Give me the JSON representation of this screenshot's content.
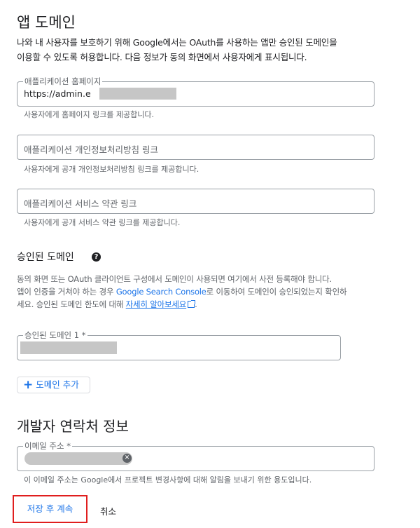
{
  "app_domain": {
    "title": "앱 도메인",
    "description_line1": "나와 내 사용자를 보호하기 위해 Google에서는 OAuth를 사용하는 앱만 승인된 도메인을",
    "description_line2": "이용할 수 있도록 허용합니다. 다음 정보가 동의 화면에서 사용자에게 표시됩니다.",
    "homepage": {
      "label": "애플리케이션 홈페이지",
      "value": "https://admin.e",
      "help": "사용자에게 홈페이지 링크를 제공합니다."
    },
    "privacy": {
      "placeholder": "애플리케이션 개인정보처리방침 링크",
      "help": "사용자에게 공개 개인정보처리방침 링크를 제공합니다."
    },
    "tos": {
      "placeholder": "애플리케이션 서비스 약관 링크",
      "help": "사용자에게 공개 서비스 약관 링크를 제공합니다."
    }
  },
  "authorized_domains": {
    "title": "승인된 도메인",
    "help_icon": "?",
    "desc_line1": "동의 화면 또는 OAuth 클라이언트 구성에서 도메인이 사용되면 여기에서 사전 등록해야 합니다.",
    "desc_line2_pre": "앱이 인증을 거쳐야 하는 경우 ",
    "desc_line2_link": "Google Search Console",
    "desc_line2_post": "로 이동하여 도메인이 승인되었는지 확인하",
    "desc_line3_pre": "세요. 승인된 도메인 한도에 대해 ",
    "desc_line3_link": "자세히 알아보세요",
    "desc_line3_post": ".",
    "domain1_label": "승인된 도메인 1 *",
    "add_button": "도메인 추가"
  },
  "developer_contact": {
    "title": "개발자 연락처 정보",
    "email_label": "이메일 주소 *",
    "chip_remove": "✕",
    "help": "이 이메일 주소는 Google에서 프로젝트 변경사항에 대해 알림을 보내기 위한 용도입니다."
  },
  "actions": {
    "save": "저장 후 계속",
    "cancel": "취소"
  },
  "colors": {
    "accent": "#1a73e8",
    "highlight_border": "#e01e1e",
    "redaction": "#c6c6c6"
  }
}
